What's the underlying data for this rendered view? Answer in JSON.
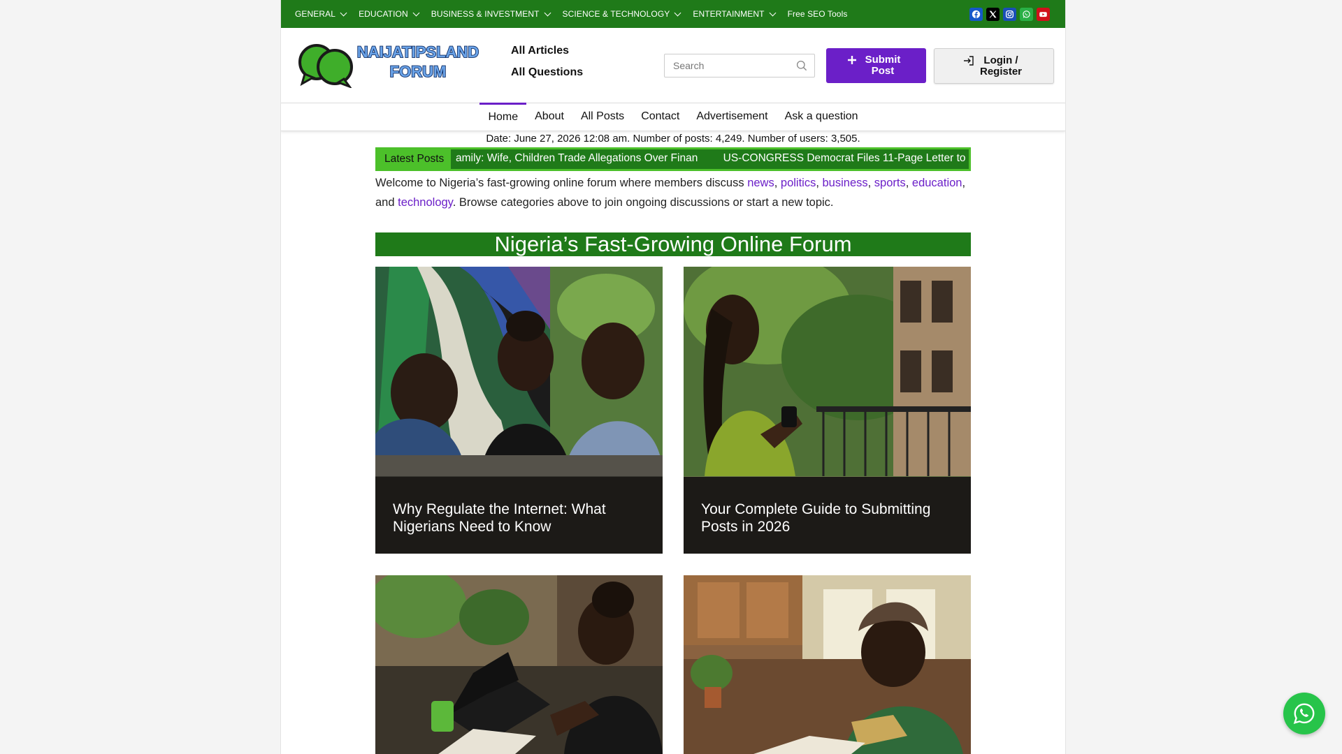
{
  "topbar": {
    "menu": [
      {
        "label": "GENERAL",
        "has_dropdown": true
      },
      {
        "label": "EDUCATION",
        "has_dropdown": true
      },
      {
        "label": "BUSINESS & INVESTMENT",
        "has_dropdown": true
      },
      {
        "label": "SCIENCE & TECHNOLOGY",
        "has_dropdown": true
      },
      {
        "label": "ENTERTAINMENT",
        "has_dropdown": true
      },
      {
        "label": "Free SEO Tools",
        "has_dropdown": false
      }
    ],
    "socials": [
      "facebook-icon",
      "x-icon",
      "instagram-icon",
      "whatsapp-icon",
      "youtube-icon"
    ],
    "bg_color": "#1f7a19"
  },
  "header": {
    "logo_line1": "NAIJATIPSLAND",
    "logo_line2": "FORUM",
    "links": [
      "All Articles",
      "All Questions"
    ],
    "search_placeholder": "Search",
    "submit_label": "Submit Post",
    "login_label": "Login / Register"
  },
  "nav": {
    "items": [
      "Home",
      "About",
      "All Posts",
      "Contact",
      "Advertisement",
      "Ask a question"
    ],
    "active": "Home",
    "accent": "#6b1fc8"
  },
  "meta": {
    "text": "Date: June 27, 2026 12:08 am. Number of posts: 4,249. Number of users: 3,505."
  },
  "ticker": {
    "label": "Latest Posts",
    "items": [
      "amily: Wife, Children Trade Allegations Over Finan",
      "US-CONGRESS Democrat Files 11-Page Letter to"
    ]
  },
  "welcome": {
    "before": "Welcome to Nigeria’s fast-growing online forum where members discuss ",
    "links": [
      "news",
      "politics",
      "business",
      "sports",
      "education",
      "technology"
    ],
    "sep1": ", ",
    "and": ", and ",
    "after": ". Browse categories above to join ongoing discussions or start a new topic."
  },
  "banner": {
    "title": "Nigeria’s Fast-Growing Online Forum"
  },
  "posts": [
    {
      "title": "Why Regulate the Internet: What Nigerians Need to Know"
    },
    {
      "title": "Your Complete Guide to Submitting Posts in 2026"
    },
    {
      "title": ""
    },
    {
      "title": ""
    }
  ]
}
